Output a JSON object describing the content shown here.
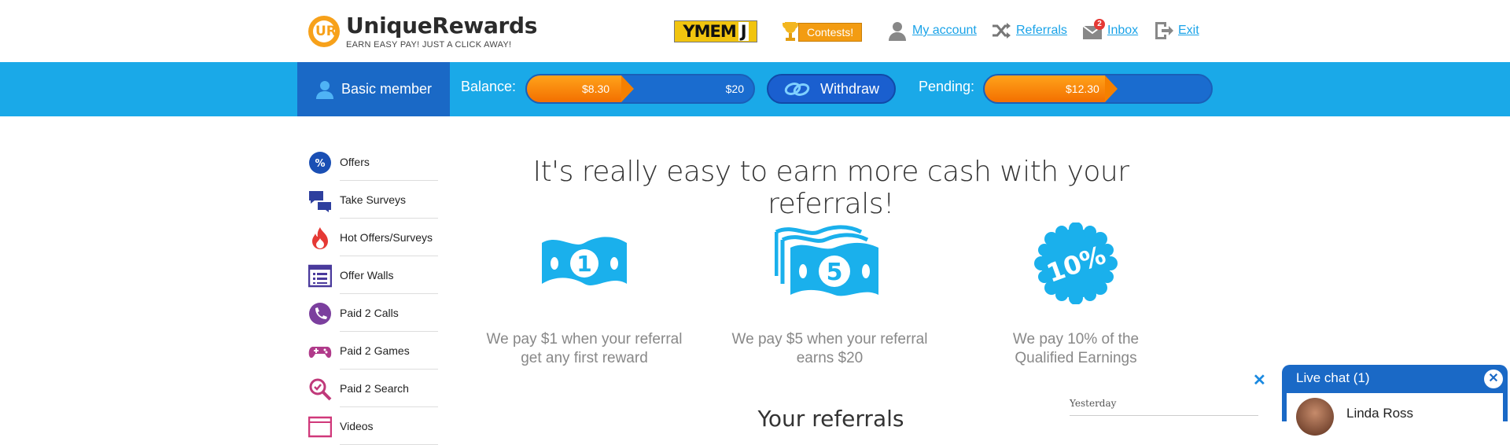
{
  "brand": {
    "title": "UniqueRewards",
    "tagline": "EARN EASY PAY! JUST A CLICK AWAY!",
    "logo_letters": "UR"
  },
  "header": {
    "ymem_logo": "YMEM",
    "ymem_j": "J",
    "contests_label": "Contests!",
    "nav": [
      {
        "label": "My account",
        "icon": "user-icon"
      },
      {
        "label": "Referrals",
        "icon": "shuffle-icon"
      },
      {
        "label": "Inbox",
        "icon": "envelope-icon",
        "badge": "2"
      },
      {
        "label": "Exit",
        "icon": "exit-icon"
      }
    ]
  },
  "statusbar": {
    "member_label": "Basic member",
    "balance_label": "Balance:",
    "balance_current": "$8.30",
    "balance_max": "$20",
    "balance_progress": 0.415,
    "withdraw_label": "Withdraw",
    "pending_label": "Pending:",
    "pending_current": "$12.30",
    "pending_progress": 0.53
  },
  "sidebar": {
    "items": [
      {
        "label": "Offers",
        "icon": "percent-badge-icon"
      },
      {
        "label": "Take Surveys",
        "icon": "chat-bubbles-icon"
      },
      {
        "label": "Hot Offers/Surveys",
        "icon": "flame-icon"
      },
      {
        "label": "Offer Walls",
        "icon": "list-window-icon"
      },
      {
        "label": "Paid 2 Calls",
        "icon": "phone-icon"
      },
      {
        "label": "Paid 2 Games",
        "icon": "gamepad-icon"
      },
      {
        "label": "Paid 2 Search",
        "icon": "search-check-icon"
      },
      {
        "label": "Videos",
        "icon": "video-icon"
      }
    ]
  },
  "main": {
    "headline": "It's really easy to earn more cash with your referrals!",
    "features": [
      {
        "art": "1",
        "text_line1": "We pay $1 when your referral",
        "text_line2": "get any first reward"
      },
      {
        "art": "5",
        "text_line1": "We pay $5 when your referral",
        "text_line2": "earns $20"
      },
      {
        "art": "10%",
        "text_line1": "We pay 10% of the",
        "text_line2": "Qualified Earnings"
      }
    ],
    "subheading": "Your referrals"
  },
  "notice": {
    "close": "✕",
    "date_label": "Yesterday"
  },
  "chat": {
    "title": "Live chat (1)",
    "close": "✕",
    "contact_name": "Linda Ross"
  },
  "colors": {
    "brand_blue": "#1aa9e8",
    "dark_blue": "#1a69c6",
    "orange": "#f58000",
    "link": "#1aa3e8"
  }
}
